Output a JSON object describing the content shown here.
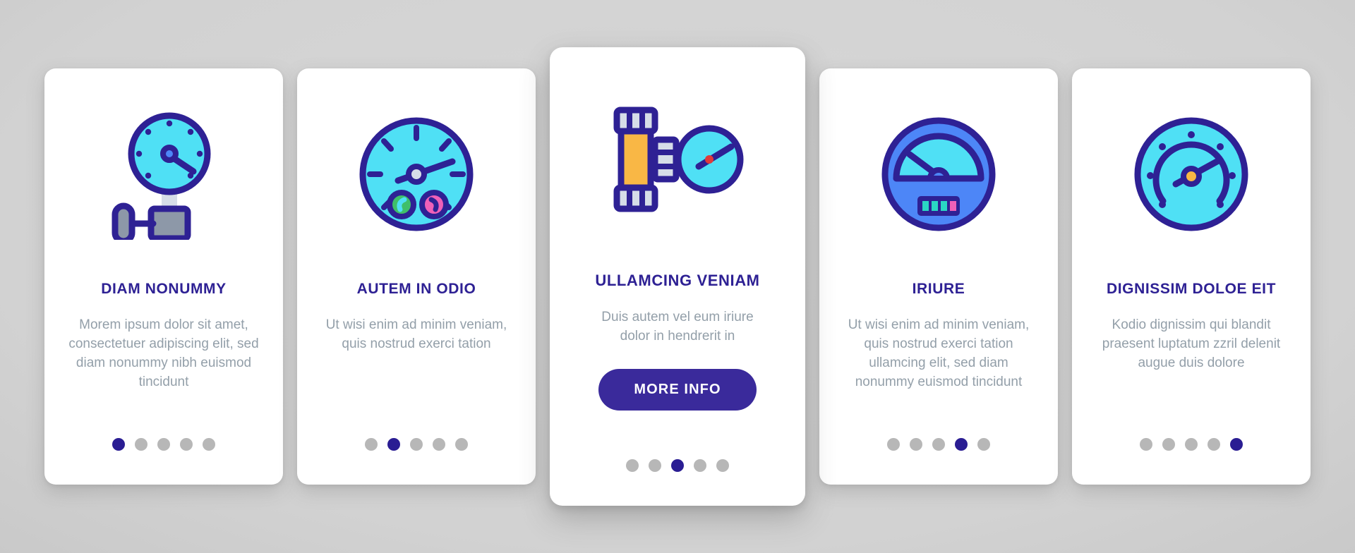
{
  "theme": {
    "background_gradient_center": "#d8d8d8",
    "background_gradient_edge": "#a8a8a8",
    "card_background": "#ffffff",
    "title_color": "#2e2194",
    "body_text_color": "#939fa9",
    "accent_indigo": "#3a2a9b",
    "dot_active_color": "#2a1d93",
    "dot_inactive_color": "#b7b7b7",
    "icon_cyan": "#4fe0f5",
    "icon_outline": "#2e2194",
    "icon_gray": "#8d98a8",
    "icon_light_gray": "#d6dde8",
    "icon_orange": "#f9b745",
    "icon_orange_dark": "#f58b4c",
    "icon_blue": "#4d86f7",
    "icon_green": "#3fbf6a",
    "icon_pink": "#f060b8"
  },
  "cards": [
    {
      "id": "card-diam-nonummy",
      "icon_name": "pressure-gauge-valve-icon",
      "title": "DIAM NONUMMY",
      "body": "Morem ipsum dolor sit amet, consectetuer adipiscing elit, sed diam nonummy nibh euismod tincidunt",
      "dots_total": 5,
      "dot_active_index": 0,
      "featured": false,
      "cta_label": null
    },
    {
      "id": "card-autem-in-odio",
      "icon_name": "speedometer-dial-icon",
      "title": "AUTEM IN ODIO",
      "body": "Ut wisi enim ad minim veniam, quis nostrud exerci tation",
      "dots_total": 5,
      "dot_active_index": 1,
      "featured": false,
      "cta_label": null
    },
    {
      "id": "card-ullamcing-veniam",
      "icon_name": "pipe-flange-manometer-icon",
      "title": "ULLAMCING VENIAM",
      "body": "Duis autem vel eum iriure dolor in hendrerit in",
      "dots_total": 5,
      "dot_active_index": 2,
      "featured": true,
      "cta_label": "MORE INFO"
    },
    {
      "id": "card-iriure",
      "icon_name": "arc-gauge-display-icon",
      "title": "IRIURE",
      "body": "Ut wisi enim ad minim veniam, quis nostrud exerci tation ullamcing elit, sed diam nonummy euismod tincidunt",
      "dots_total": 5,
      "dot_active_index": 3,
      "featured": false,
      "cta_label": null
    },
    {
      "id": "card-dignissim-doloe-eit",
      "icon_name": "round-pressure-meter-icon",
      "title": "DIGNISSIM DOLOE EIT",
      "body": "Kodio dignissim qui blandit praesent luptatum zzril delenit augue duis dolore",
      "dots_total": 5,
      "dot_active_index": 4,
      "featured": false,
      "cta_label": null
    }
  ]
}
